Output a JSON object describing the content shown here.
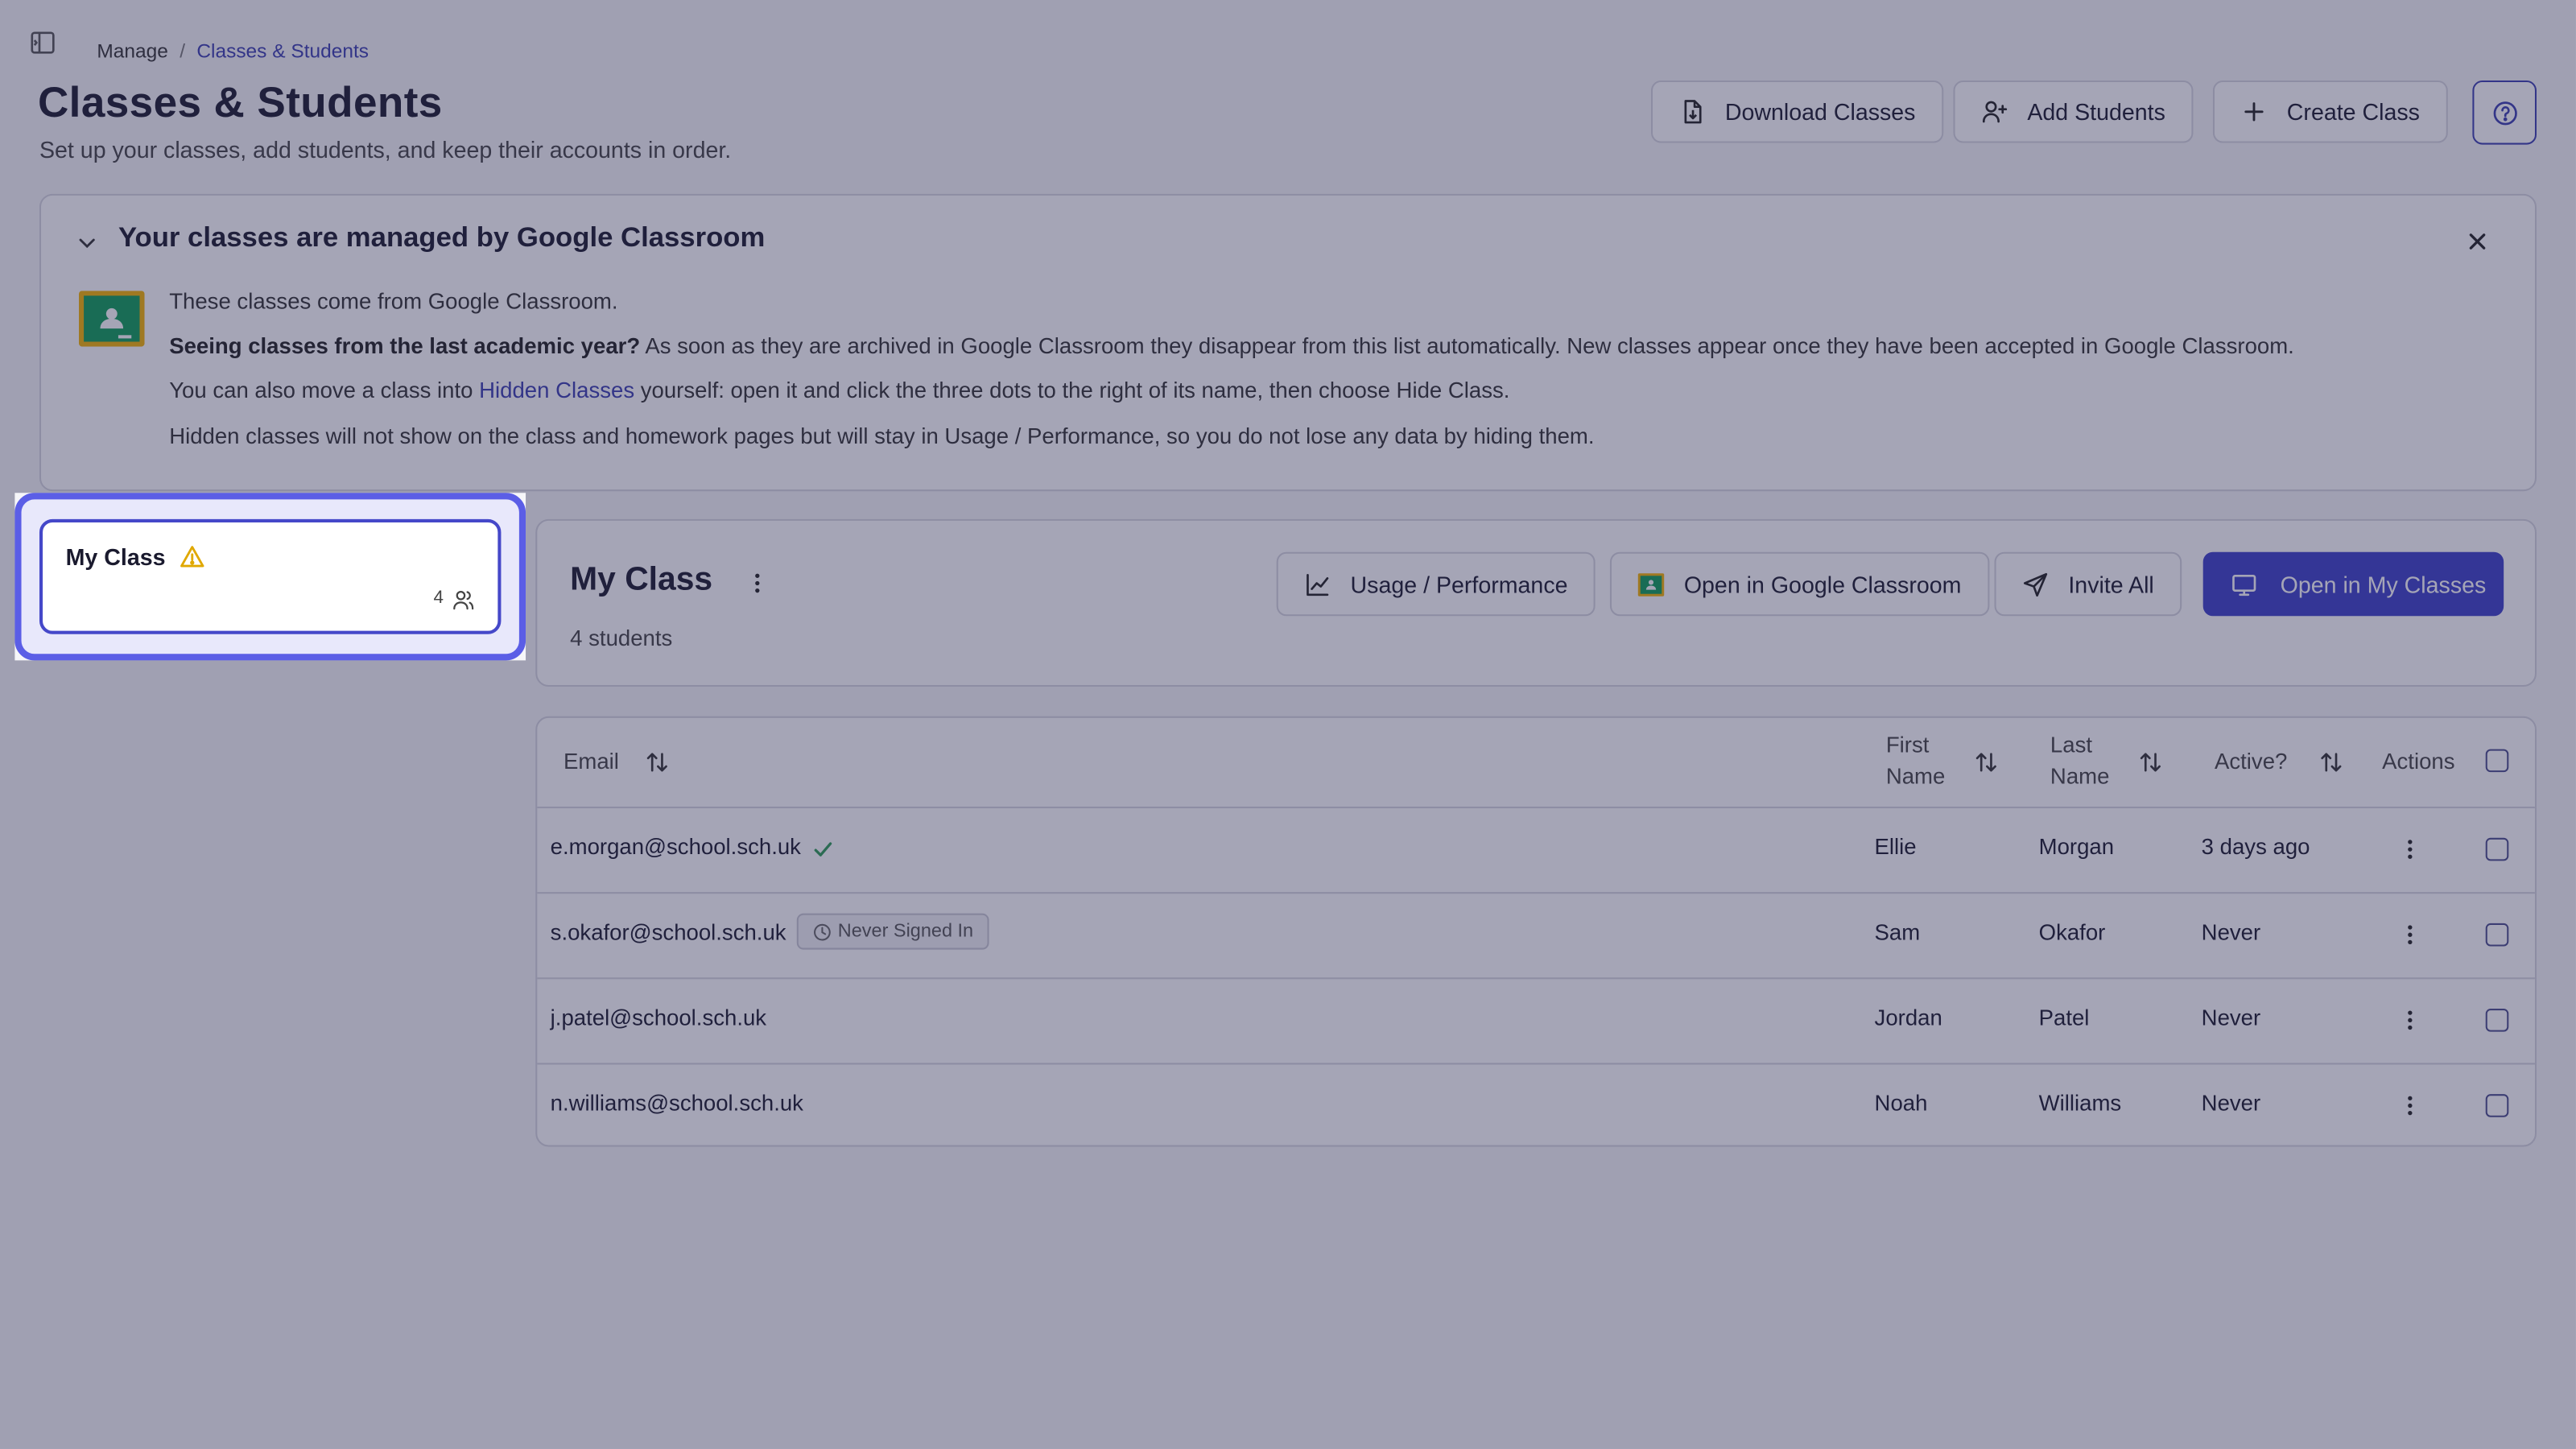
{
  "breadcrumb": {
    "root": "Manage",
    "separator": "/",
    "current": "Classes & Students"
  },
  "header": {
    "title": "Classes & Students",
    "subtitle": "Set up your classes, add students, and keep their accounts in order.",
    "download_label": "Download Classes",
    "add_students_label": "Add Students",
    "create_class_label": "Create Class"
  },
  "banner": {
    "title": "Your classes are managed by Google Classroom",
    "line1": "These classes come from Google Classroom.",
    "line2_bold": "Seeing classes from the last academic year?",
    "line2_rest": " As soon as they are archived in Google Classroom they disappear from this list automatically. New classes appear once they have been accepted in Google Classroom.",
    "line3_pre": "You can also move a class into ",
    "line3_link": "Hidden Classes",
    "line3_post": " yourself: open it and click the three dots to the right of its name, then choose Hide Class.",
    "line4": "Hidden classes will not show on the class and homework pages but will stay in Usage / Performance, so you do not lose any data by hiding them."
  },
  "class_card": {
    "name": "My Class",
    "student_count": "4"
  },
  "class_panel": {
    "title": "My Class",
    "subtitle": "4 students",
    "usage_label": "Usage / Performance",
    "open_google_label": "Open in Google Classroom",
    "invite_label": "Invite All",
    "open_my_classes_label": "Open in My Classes"
  },
  "table": {
    "headers": {
      "email": "Email",
      "first_name_1": "First",
      "first_name_2": "Name",
      "last_name_1": "Last",
      "last_name_2": "Name",
      "active": "Active?",
      "actions": "Actions"
    },
    "rows": [
      {
        "email": "e.morgan@school.sch.uk",
        "first": "Ellie",
        "last": "Morgan",
        "active": "3 days ago",
        "status": "verified"
      },
      {
        "email": "s.okafor@school.sch.uk",
        "first": "Sam",
        "last": "Okafor",
        "active": "Never",
        "badge": "Never Signed In"
      },
      {
        "email": "j.patel@school.sch.uk",
        "first": "Jordan",
        "last": "Patel",
        "active": "Never"
      },
      {
        "email": "n.williams@school.sch.uk",
        "first": "Noah",
        "last": "Williams",
        "active": "Never"
      }
    ]
  },
  "colors": {
    "accent": "#3d40c8",
    "highlight_ring": "#5b5ee6",
    "verified": "#2e9b55",
    "overlay": "rgba(40,40,80,0.42)"
  },
  "icons": [
    "sidebar-toggle-icon",
    "file-download-icon",
    "user-plus-icon",
    "plus-icon",
    "help-icon",
    "chevron-down-icon",
    "close-icon",
    "google-classroom-icon",
    "warning-icon",
    "users-icon",
    "kebab-icon",
    "chart-line-icon",
    "send-icon",
    "monitor-icon",
    "sort-icon",
    "check-icon",
    "clock-icon"
  ]
}
